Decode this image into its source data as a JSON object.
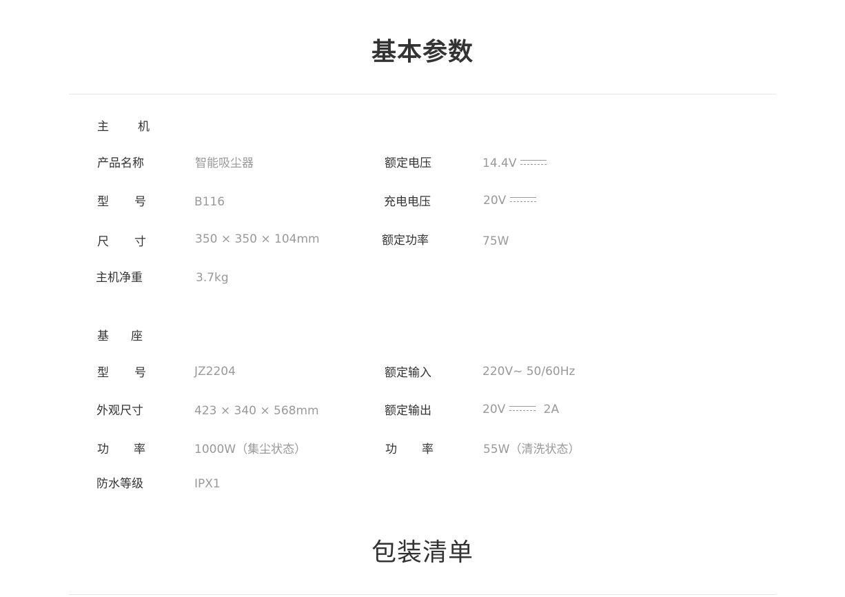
{
  "titles": {
    "basic_params": "基本参数",
    "package_list": "包装清单"
  },
  "host": {
    "group_label": [
      "主",
      "机"
    ],
    "rows": [
      {
        "left_label": "产品名称",
        "left_value": "智能吸尘器",
        "right_label": "额定电压",
        "right_value": "14.4V"
      },
      {
        "left_label": [
          "型",
          "号"
        ],
        "left_value": "B116",
        "right_label": "充电电压",
        "right_value": "20V"
      },
      {
        "left_label": [
          "尺",
          "寸"
        ],
        "left_value": "350 × 350 × 104mm",
        "right_label": "额定功率",
        "right_value": "75W"
      },
      {
        "left_label": "主机净重",
        "left_value": "3.7kg"
      }
    ]
  },
  "base": {
    "group_label": [
      "基",
      "座"
    ],
    "rows": [
      {
        "left_label": [
          "型",
          "号"
        ],
        "left_value": "JZ2204",
        "right_label": "额定输入",
        "right_value": "220V~ 50/60Hz"
      },
      {
        "left_label": "外观尺寸",
        "left_value": "423 × 340 × 568mm",
        "right_label": "额定输出",
        "right_value": "20V",
        "right_value_suffix": "2A"
      },
      {
        "left_label": [
          "功",
          "率"
        ],
        "left_value": "1000W（集尘状态）",
        "right_label": [
          "功",
          "率"
        ],
        "right_value": "55W（清洗状态）"
      },
      {
        "left_label": "防水等级",
        "left_value": "IPX1"
      }
    ]
  },
  "icons": {
    "dc_symbol": "dc-current-symbol-icon"
  }
}
